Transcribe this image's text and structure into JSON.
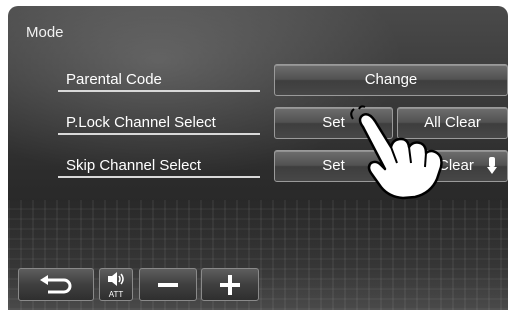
{
  "screen": {
    "title": "Mode"
  },
  "rows": [
    {
      "label": "Parental Code",
      "buttons": [
        "Change"
      ]
    },
    {
      "label": "P.Lock Channel Select",
      "buttons": [
        "Set",
        "All Clear"
      ]
    },
    {
      "label": "Skip Channel Select",
      "buttons": [
        "Set",
        "All Clear"
      ]
    }
  ],
  "bottom_bar": {
    "att_label": "ATT"
  },
  "icons": [
    "return-icon",
    "speaker-icon",
    "minus-icon",
    "plus-icon",
    "scroll-arrow-icon",
    "pointing-hand-icon"
  ]
}
